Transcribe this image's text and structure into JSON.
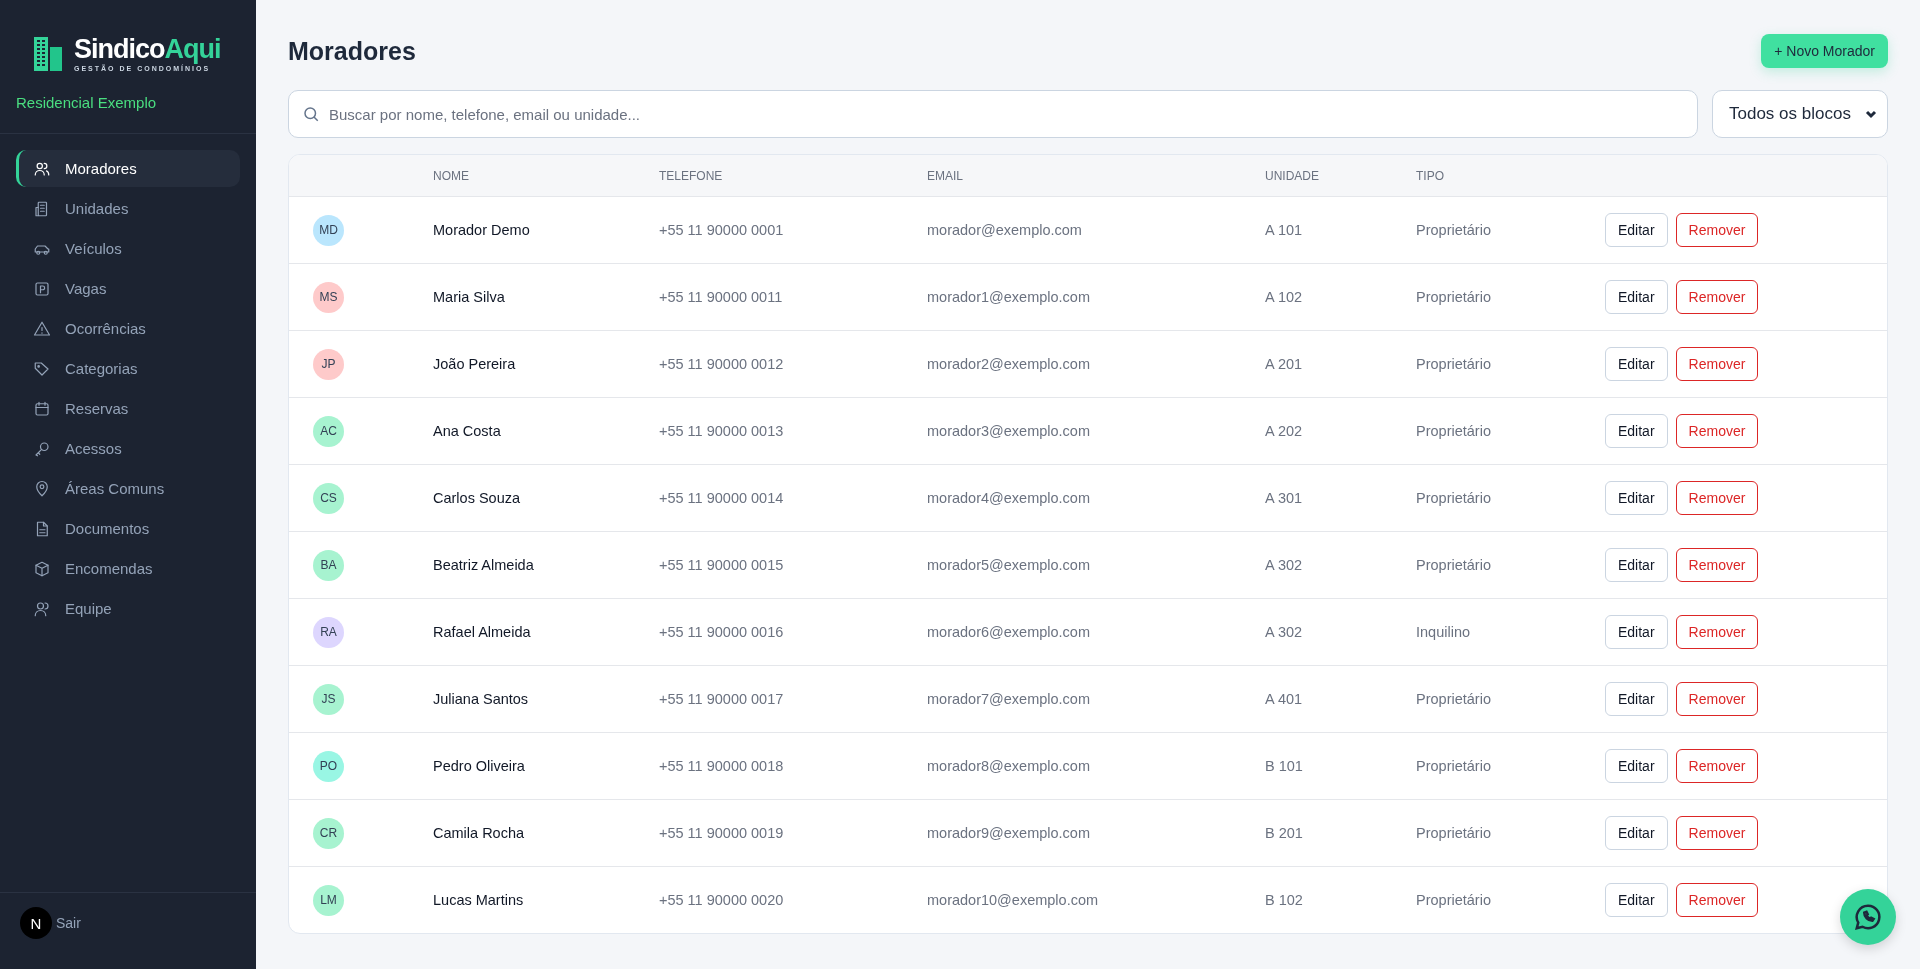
{
  "sidebar": {
    "brand": {
      "name_part1": "Sindico",
      "name_part2": "Aqui",
      "tagline": "GESTÃO DE CONDOMÍNIOS"
    },
    "condominium": "Residencial Exemplo",
    "items": [
      {
        "label": "Moradores",
        "selected": true
      },
      {
        "label": "Unidades",
        "selected": false
      },
      {
        "label": "Veículos",
        "selected": false
      },
      {
        "label": "Vagas",
        "selected": false
      },
      {
        "label": "Ocorrências",
        "selected": false
      },
      {
        "label": "Categorias",
        "selected": false
      },
      {
        "label": "Reservas",
        "selected": false
      },
      {
        "label": "Acessos",
        "selected": false
      },
      {
        "label": "Áreas Comuns",
        "selected": false
      },
      {
        "label": "Documentos",
        "selected": false
      },
      {
        "label": "Encomendas",
        "selected": false
      },
      {
        "label": "Equipe",
        "selected": false
      }
    ],
    "user": {
      "initial": "N",
      "logout": "Sair"
    }
  },
  "header": {
    "title": "Moradores",
    "new_button": "+ Novo Morador"
  },
  "search": {
    "placeholder": "Buscar por nome, telefone, email ou unidade..."
  },
  "block_filter": {
    "value": "Todos os blocos"
  },
  "table": {
    "columns": [
      "NOME",
      "TELEFONE",
      "EMAIL",
      "UNIDADE",
      "TIPO"
    ],
    "rows": [
      {
        "initials": "MD",
        "color": "#bae6fd",
        "name": "Morador Demo",
        "phone": "+55 11 90000 0001",
        "email": "morador@exemplo.com",
        "unit": "A 101",
        "type": "Proprietário",
        "edit": "Editar",
        "remove": "Remover"
      },
      {
        "initials": "MS",
        "color": "#fecaca",
        "name": "Maria Silva",
        "phone": "+55 11 90000 0011",
        "email": "morador1@exemplo.com",
        "unit": "A 102",
        "type": "Proprietário",
        "edit": "Editar",
        "remove": "Remover"
      },
      {
        "initials": "JP",
        "color": "#fecaca",
        "name": "João Pereira",
        "phone": "+55 11 90000 0012",
        "email": "morador2@exemplo.com",
        "unit": "A 201",
        "type": "Proprietário",
        "edit": "Editar",
        "remove": "Remover"
      },
      {
        "initials": "AC",
        "color": "#a7f3d0",
        "name": "Ana Costa",
        "phone": "+55 11 90000 0013",
        "email": "morador3@exemplo.com",
        "unit": "A 202",
        "type": "Proprietário",
        "edit": "Editar",
        "remove": "Remover"
      },
      {
        "initials": "CS",
        "color": "#a7f3d0",
        "name": "Carlos Souza",
        "phone": "+55 11 90000 0014",
        "email": "morador4@exemplo.com",
        "unit": "A 301",
        "type": "Proprietário",
        "edit": "Editar",
        "remove": "Remover"
      },
      {
        "initials": "BA",
        "color": "#a7f3d0",
        "name": "Beatriz Almeida",
        "phone": "+55 11 90000 0015",
        "email": "morador5@exemplo.com",
        "unit": "A 302",
        "type": "Proprietário",
        "edit": "Editar",
        "remove": "Remover"
      },
      {
        "initials": "RA",
        "color": "#ddd6fe",
        "name": "Rafael Almeida",
        "phone": "+55 11 90000 0016",
        "email": "morador6@exemplo.com",
        "unit": "A 302",
        "type": "Inquilino",
        "edit": "Editar",
        "remove": "Remover"
      },
      {
        "initials": "JS",
        "color": "#a7f3d0",
        "name": "Juliana Santos",
        "phone": "+55 11 90000 0017",
        "email": "morador7@exemplo.com",
        "unit": "A 401",
        "type": "Proprietário",
        "edit": "Editar",
        "remove": "Remover"
      },
      {
        "initials": "PO",
        "color": "#99f6e4",
        "name": "Pedro Oliveira",
        "phone": "+55 11 90000 0018",
        "email": "morador8@exemplo.com",
        "unit": "B 101",
        "type": "Proprietário",
        "edit": "Editar",
        "remove": "Remover"
      },
      {
        "initials": "CR",
        "color": "#a7f3d0",
        "name": "Camila Rocha",
        "phone": "+55 11 90000 0019",
        "email": "morador9@exemplo.com",
        "unit": "B 201",
        "type": "Proprietário",
        "edit": "Editar",
        "remove": "Remover"
      },
      {
        "initials": "LM",
        "color": "#a7f3d0",
        "name": "Lucas Martins",
        "phone": "+55 11 90000 0020",
        "email": "morador10@exemplo.com",
        "unit": "B 102",
        "type": "Proprietário",
        "edit": "Editar",
        "remove": "Remover"
      }
    ]
  }
}
